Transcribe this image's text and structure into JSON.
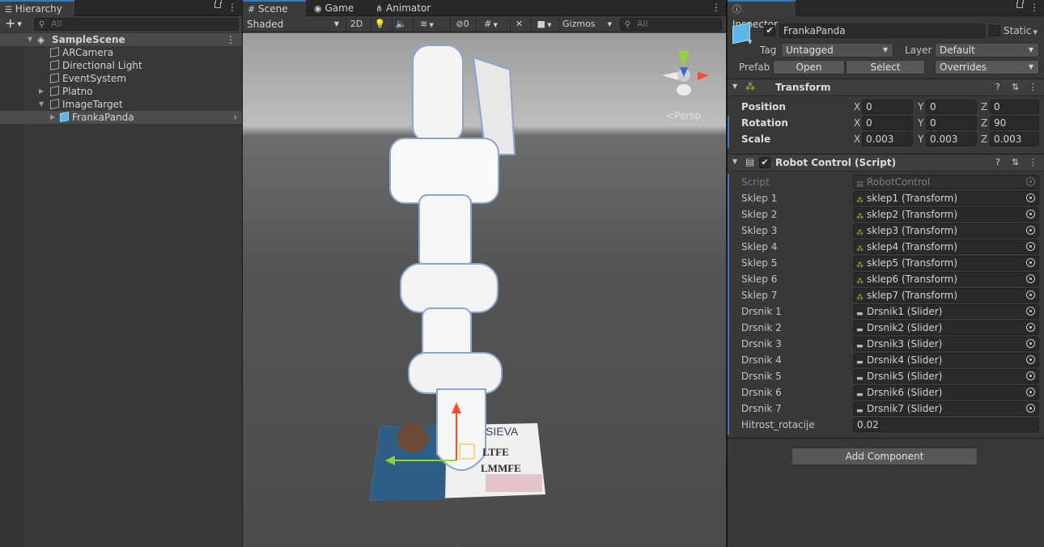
{
  "hierarchy": {
    "tab_label": "Hierarchy",
    "add_label": "+",
    "search_placeholder": "All",
    "scene_name": "SampleScene",
    "items": [
      {
        "label": "ARCamera"
      },
      {
        "label": "Directional Light"
      },
      {
        "label": "EventSystem"
      },
      {
        "label": "Platno"
      },
      {
        "label": "ImageTarget"
      },
      {
        "label": "FrankaPanda"
      }
    ]
  },
  "scene": {
    "tabs": [
      {
        "label": "Scene"
      },
      {
        "label": "Game"
      },
      {
        "label": "Animator"
      }
    ],
    "shading_mode": "Shaded",
    "mode_2d": "2D",
    "hidden_count": "0",
    "gizmos_label": "Gizmos",
    "search_placeholder": "All",
    "persp_label": "Persp",
    "target_logo": "SIEVA",
    "target_text_1": "LTFE",
    "target_text_2": "LMMFE"
  },
  "inspector": {
    "tab_label": "Inspector",
    "object_name": "FrankaPanda",
    "static_label": "Static",
    "tag_label": "Tag",
    "tag_value": "Untagged",
    "layer_label": "Layer",
    "layer_value": "Default",
    "prefab_label": "Prefab",
    "open_label": "Open",
    "select_label": "Select",
    "overrides_label": "Overrides",
    "transform": {
      "title": "Transform",
      "position_label": "Position",
      "rotation_label": "Rotation",
      "scale_label": "Scale",
      "x": "X",
      "y": "Y",
      "z": "Z",
      "position": [
        "0",
        "0",
        "0"
      ],
      "rotation": [
        "0",
        "0",
        "90"
      ],
      "scale": [
        "0.003",
        "0.003",
        "0.003"
      ]
    },
    "script_component": {
      "title": "Robot Control (Script)",
      "script_label": "Script",
      "script_value": "RobotControl",
      "fields": [
        {
          "label": "Sklep 1",
          "value": "sklep1 (Transform)"
        },
        {
          "label": "Sklep 2",
          "value": "sklep2 (Transform)"
        },
        {
          "label": "Sklep 3",
          "value": "sklep3 (Transform)"
        },
        {
          "label": "Sklep 4",
          "value": "sklep4 (Transform)"
        },
        {
          "label": "Sklep 5",
          "value": "sklep5 (Transform)"
        },
        {
          "label": "Sklep 6",
          "value": "sklep6 (Transform)"
        },
        {
          "label": "Sklep 7",
          "value": "sklep7 (Transform)"
        },
        {
          "label": "Drsnik 1",
          "value": "Drsnik1 (Slider)"
        },
        {
          "label": "Drsnik 2",
          "value": "Drsnik2 (Slider)"
        },
        {
          "label": "Drsnik 3",
          "value": "Drsnik3 (Slider)"
        },
        {
          "label": "Drsnik 4",
          "value": "Drsnik4 (Slider)"
        },
        {
          "label": "Drsnik 5",
          "value": "Drsnik5 (Slider)"
        },
        {
          "label": "Drsnik 6",
          "value": "Drsnik6 (Slider)"
        },
        {
          "label": "Drsnik 7",
          "value": "Drsnik7 (Slider)"
        }
      ],
      "speed_label": "Hitrost_rotacije",
      "speed_value": "0.02"
    },
    "add_component_label": "Add Component"
  },
  "colors": {
    "accent": "#3a79bb",
    "selected_row": "#4d4d4d",
    "panel_bg": "#383838",
    "cube_icon": "#5cb7e8"
  }
}
